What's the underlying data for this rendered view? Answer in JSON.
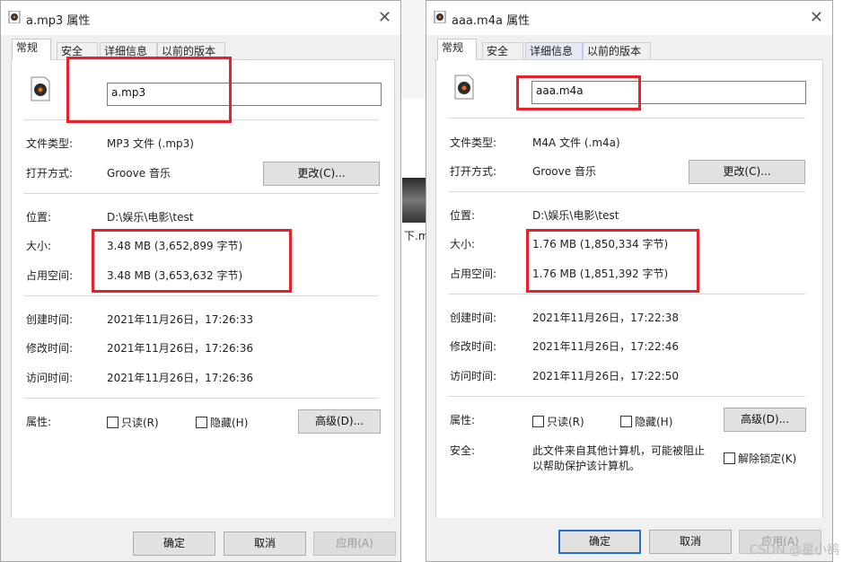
{
  "background": {
    "partial_label": "下.m"
  },
  "left": {
    "title": "a.mp3 属性",
    "tabs": [
      "常规",
      "安全",
      "详细信息",
      "以前的版本"
    ],
    "filename": "a.mp3",
    "labels": {
      "type": "文件类型:",
      "open_with": "打开方式:",
      "location": "位置:",
      "size": "大小:",
      "size_on_disk": "占用空间:",
      "created": "创建时间:",
      "modified": "修改时间:",
      "accessed": "访问时间:",
      "attributes": "属性:"
    },
    "values": {
      "type": "MP3 文件 (.mp3)",
      "open_with": "Groove 音乐",
      "location": "D:\\娱乐\\电影\\test",
      "size": "3.48 MB (3,652,899 字节)",
      "size_on_disk": "3.48 MB (3,653,632 字节)",
      "created": "2021年11月26日，17:26:33",
      "modified": "2021年11月26日，17:26:36",
      "accessed": "2021年11月26日，17:26:36"
    },
    "buttons": {
      "change": "更改(C)...",
      "advanced": "高级(D)...",
      "ok": "确定",
      "cancel": "取消",
      "apply": "应用(A)"
    },
    "checkboxes": {
      "readonly": "只读(R)",
      "hidden": "隐藏(H)"
    }
  },
  "right": {
    "title": "aaa.m4a 属性",
    "tabs": [
      "常规",
      "安全",
      "详细信息",
      "以前的版本"
    ],
    "filename": "aaa.m4a",
    "labels": {
      "type": "文件类型:",
      "open_with": "打开方式:",
      "location": "位置:",
      "size": "大小:",
      "size_on_disk": "占用空间:",
      "created": "创建时间:",
      "modified": "修改时间:",
      "accessed": "访问时间:",
      "attributes": "属性:",
      "security": "安全:"
    },
    "values": {
      "type": "M4A 文件 (.m4a)",
      "open_with": "Groove 音乐",
      "location": "D:\\娱乐\\电影\\test",
      "size": "1.76 MB (1,850,334 字节)",
      "size_on_disk": "1.76 MB (1,851,392 字节)",
      "created": "2021年11月26日，17:22:38",
      "modified": "2021年11月26日，17:22:46",
      "accessed": "2021年11月26日，17:22:50",
      "security_line1": "此文件来自其他计算机，可能被阻止",
      "security_line2": "以帮助保护该计算机。"
    },
    "buttons": {
      "change": "更改(C)...",
      "advanced": "高级(D)...",
      "ok": "确定",
      "cancel": "取消",
      "apply": "应用(A)"
    },
    "checkboxes": {
      "readonly": "只读(R)",
      "hidden": "隐藏(H)",
      "unblock": "解除锁定(K)"
    }
  },
  "watermark": "CSDN @星小鹆",
  "colors": {
    "highlight": "#e8202a",
    "focus": "#2b6ec9"
  }
}
